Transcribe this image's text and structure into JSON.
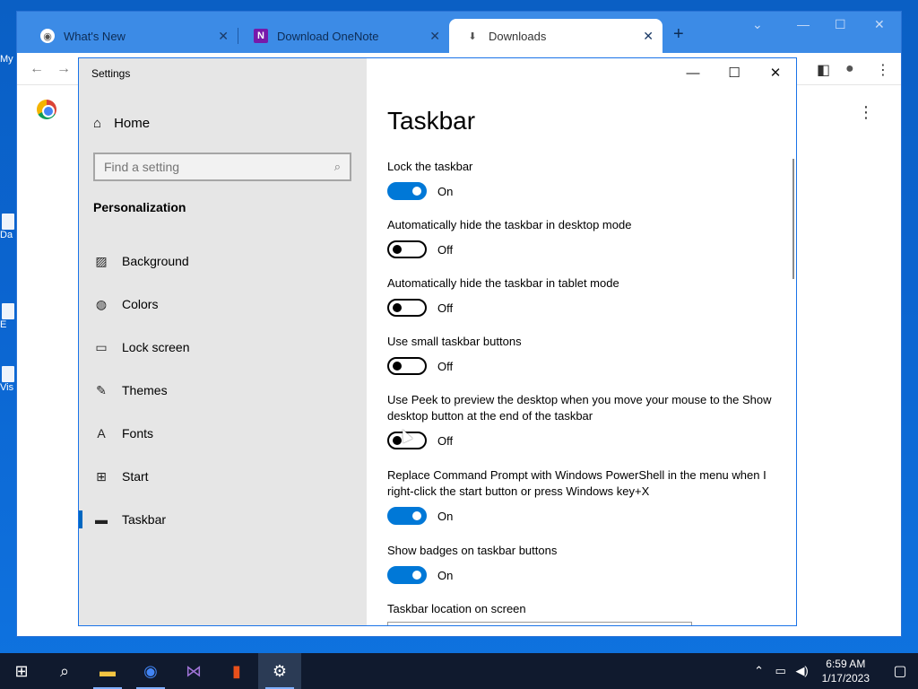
{
  "desktop": {
    "icon_labels": [
      "My",
      "Da",
      "E",
      "Vis"
    ]
  },
  "chrome": {
    "tabs": [
      {
        "title": "What's New",
        "icon": "chrome-icon"
      },
      {
        "title": "Download OneNote",
        "icon": "onenote-icon"
      },
      {
        "title": "Downloads",
        "icon": "download-icon",
        "active": true
      }
    ],
    "new_tab": "+",
    "minimize": "⌄",
    "window_min": "—",
    "window_max": "☐",
    "window_close": "✕",
    "back": "←",
    "forward": "→",
    "menu": "⋮"
  },
  "settings": {
    "window_title": "Settings",
    "home_label": "Home",
    "search_placeholder": "Find a setting",
    "section": "Personalization",
    "nav": [
      {
        "label": "Background",
        "icon": "picture-icon"
      },
      {
        "label": "Colors",
        "icon": "palette-icon"
      },
      {
        "label": "Lock screen",
        "icon": "lock-screen-icon"
      },
      {
        "label": "Themes",
        "icon": "themes-icon"
      },
      {
        "label": "Fonts",
        "icon": "fonts-icon"
      },
      {
        "label": "Start",
        "icon": "start-icon"
      },
      {
        "label": "Taskbar",
        "icon": "taskbar-icon",
        "active": true
      }
    ],
    "page_title": "Taskbar",
    "options": [
      {
        "label": "Lock the taskbar",
        "state": "On"
      },
      {
        "label": "Automatically hide the taskbar in desktop mode",
        "state": "Off"
      },
      {
        "label": "Automatically hide the taskbar in tablet mode",
        "state": "Off"
      },
      {
        "label": "Use small taskbar buttons",
        "state": "Off"
      },
      {
        "label": "Use Peek to preview the desktop when you move your mouse to the Show desktop button at the end of the taskbar",
        "state": "Off"
      },
      {
        "label": "Replace Command Prompt with Windows PowerShell in the menu when I right-click the start button or press Windows key+X",
        "state": "On"
      },
      {
        "label": "Show badges on taskbar buttons",
        "state": "On"
      }
    ],
    "location_label": "Taskbar location on screen"
  },
  "taskbar": {
    "time": "6:59 AM",
    "date": "1/17/2023"
  }
}
